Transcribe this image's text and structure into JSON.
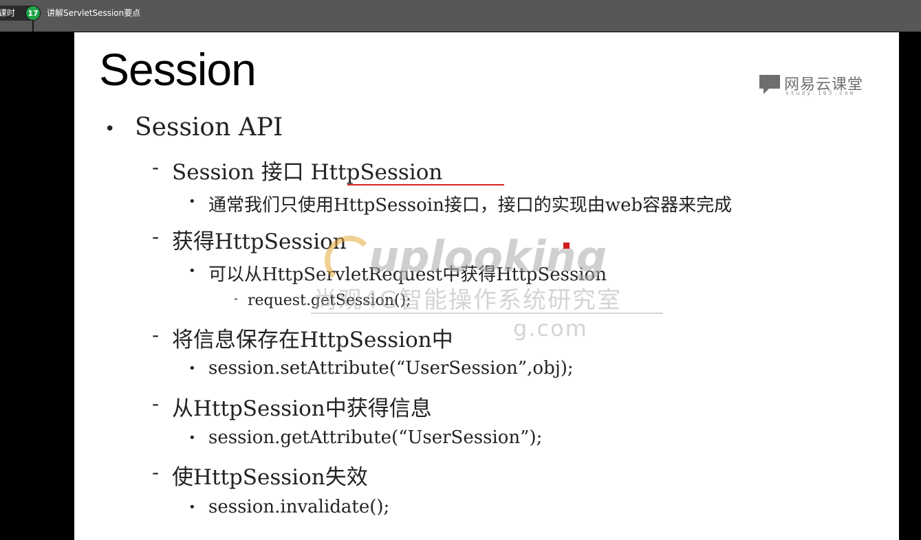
{
  "top_bar": {
    "lesson_label": "课时",
    "lesson_number": "17",
    "lesson_title": "讲解ServletSession要点"
  },
  "slide": {
    "title": "Session",
    "logo": {
      "name": "网易云课堂",
      "sub": "study.163.com"
    },
    "watermark": {
      "brand": "uplooking",
      "org": "尚观4G智能操作系统研究室",
      "url": "g.com"
    },
    "items": [
      {
        "level": 1,
        "text": "Session API"
      },
      {
        "level": 2,
        "text": "Session 接口 HttpSession"
      },
      {
        "level": 3,
        "text": "通常我们只使用HttpSessoin接口，接口的实现由web容器来完成"
      },
      {
        "level": 2,
        "text": "获得HttpSession"
      },
      {
        "level": 3,
        "text": "可以从HttpServletRequest中获得HttpSession"
      },
      {
        "level": 4,
        "text": "request.getSession();"
      },
      {
        "level": 2,
        "text": "将信息保存在HttpSession中"
      },
      {
        "level": 3,
        "text": "session.setAttribute(“UserSession”,obj);"
      },
      {
        "level": 2,
        "text": "从HttpSession中获得信息"
      },
      {
        "level": 3,
        "text": "session.getAttribute(“UserSession”);"
      },
      {
        "level": 2,
        "text": "使HttpSession失效"
      },
      {
        "level": 3,
        "text": "session.invalidate();"
      }
    ]
  }
}
